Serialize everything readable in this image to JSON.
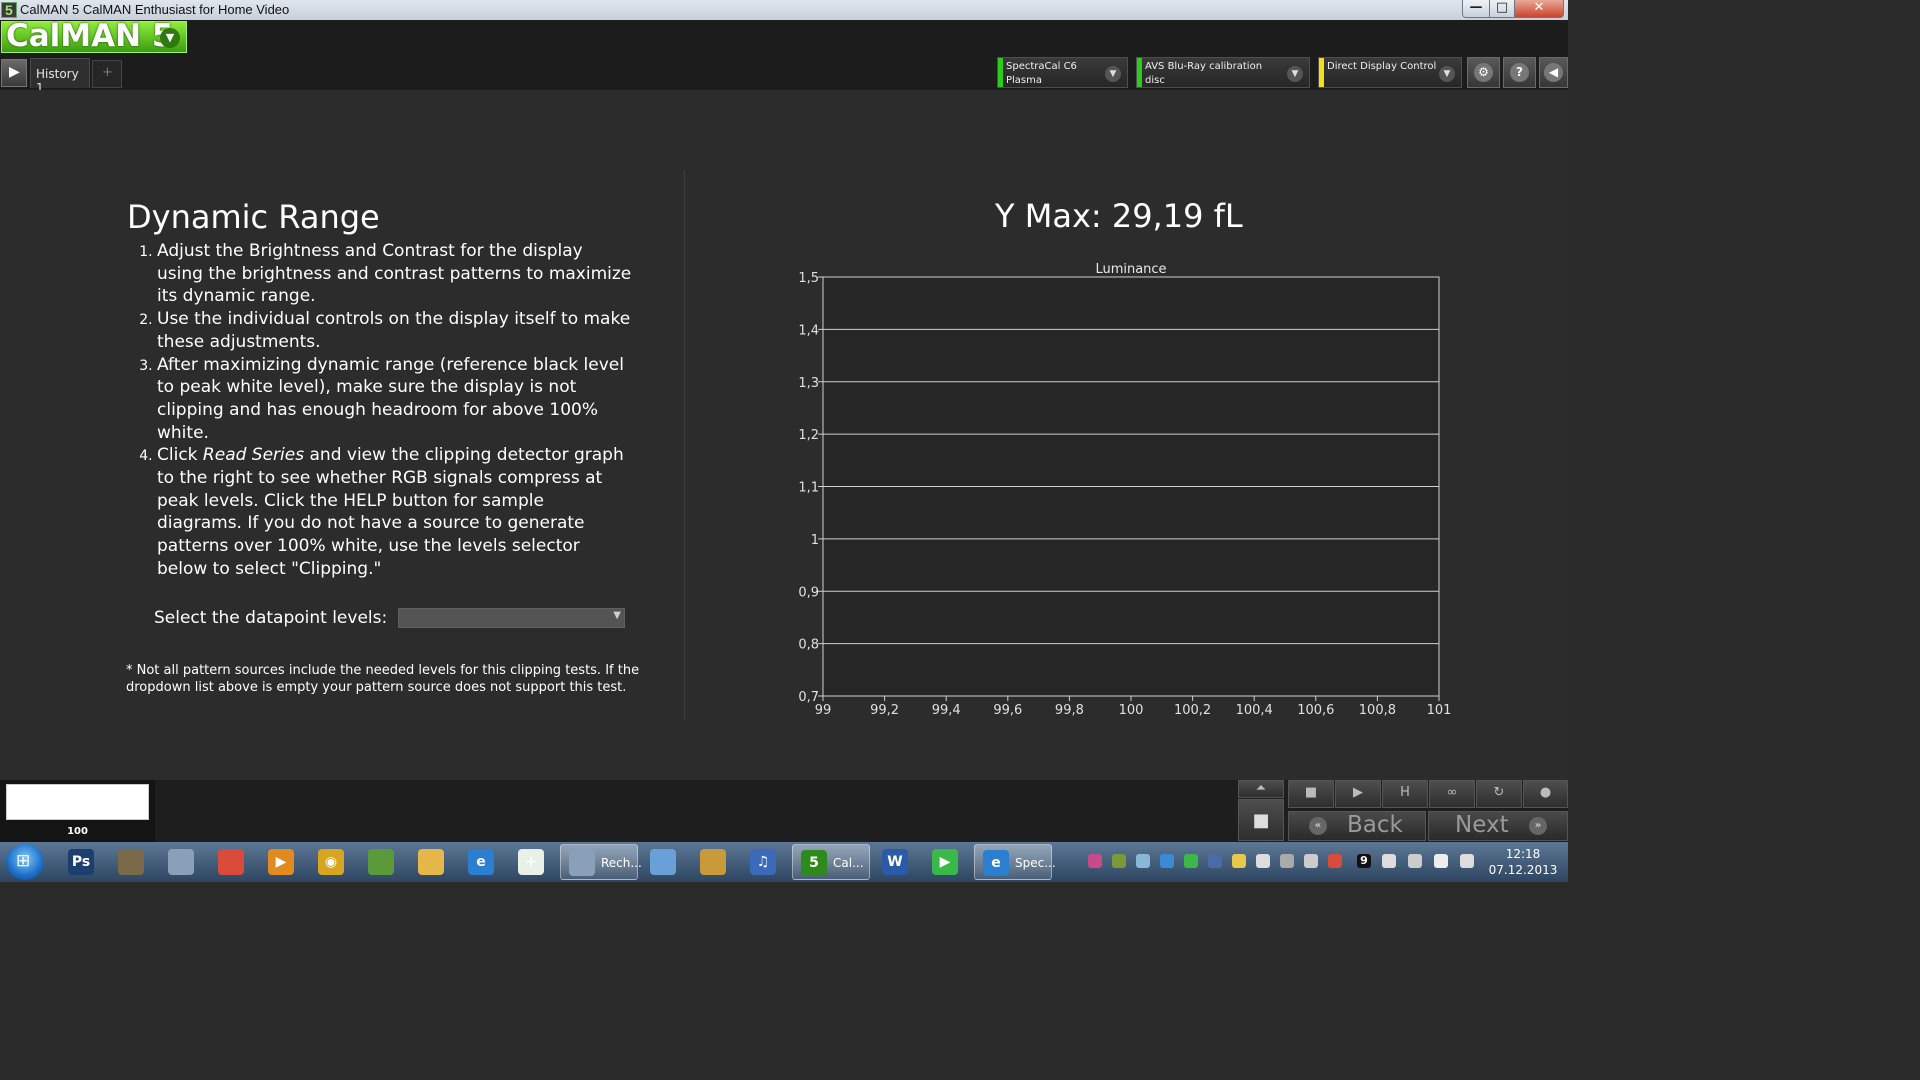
{
  "window": {
    "title": "CalMAN 5 CalMAN Enthusiast for Home Video",
    "app_icon_glyph": "5",
    "minimize_glyph": "—",
    "maximize_glyph": "□",
    "close_glyph": "✕"
  },
  "header": {
    "logo": "CalMAN 5",
    "logo_dropdown_glyph": "▼",
    "play_glyph": "▶",
    "tabs": [
      {
        "label": "History 1"
      }
    ],
    "add_tab_glyph": "+",
    "devices": [
      {
        "label": "SpectraCal C6 Plasma",
        "stripe_color": "#2ecc1a"
      },
      {
        "label": "AVS Blu-Ray calibration disc",
        "stripe_color": "#2ecc1a"
      },
      {
        "label": "Direct Display Control",
        "stripe_color": "#f2e01a"
      }
    ],
    "settings_glyph": "⚙",
    "help_glyph": "?",
    "collapse_glyph": "◀"
  },
  "content": {
    "title": "Dynamic Range",
    "steps": [
      {
        "text": "Adjust the Brightness and Contrast for the display using the brightness and contrast patterns to maximize its dynamic range."
      },
      {
        "text": "Use the individual controls on the display itself to make these adjustments."
      },
      {
        "text": "After maximizing dynamic range (reference black level to peak white level), make sure the display is not clipping and has enough headroom for above 100% white."
      },
      {
        "text_before": "Click ",
        "text_italic": "Read Series",
        "text_after": " and view the clipping detector graph to the right to see whether RGB signals compress at peak levels. Click the HELP button for sample diagrams. If you do not have a source to generate patterns over 100% white, use the levels selector below to select \"Clipping.\""
      }
    ],
    "levels_label": "Select the datapoint levels:",
    "levels_value": "",
    "footnote": "* Not all pattern sources include the needed levels for this clipping tests.  If the dropdown list above is empty your pattern source does not support this test.",
    "ymax": "Y Max: 29,19 fL"
  },
  "chart_data": {
    "type": "line",
    "title": "Luminance",
    "xlim": [
      99,
      101
    ],
    "ylim": [
      0.7,
      1.5
    ],
    "x_ticks": [
      "99",
      "99,2",
      "99,4",
      "99,6",
      "99,8",
      "100",
      "100,2",
      "100,4",
      "100,6",
      "100,8",
      "101"
    ],
    "y_ticks": [
      "0,7",
      "0,8",
      "0,9",
      "1",
      "1,1",
      "1,2",
      "1,3",
      "1,4",
      "1,5"
    ],
    "grid": true,
    "series": []
  },
  "bottom": {
    "swatch_color": "#ffffff",
    "swatch_label": "100",
    "controls": {
      "up_glyph": "⏶",
      "stop_glyph": "■",
      "play_glyph": "▶",
      "save_glyph": "H",
      "loop_glyph": "∞",
      "refresh_glyph": "↻",
      "record_glyph": "●",
      "stop_big_glyph": "■",
      "back_label": "Back",
      "back_glyph": "«",
      "next_label": "Next",
      "next_glyph": "»"
    }
  },
  "taskbar": {
    "start_glyph": "⊞",
    "items": [
      {
        "name": "photoshop",
        "color": "#1d3f6e",
        "glyph": "Ps",
        "label": ""
      },
      {
        "name": "photo-viewer",
        "color": "#7a6a4a",
        "glyph": "",
        "label": ""
      },
      {
        "name": "computer",
        "color": "#8aa0b8",
        "glyph": "",
        "label": ""
      },
      {
        "name": "chrome",
        "color": "#d84a3a",
        "glyph": "",
        "label": ""
      },
      {
        "name": "media",
        "color": "#e08a20",
        "glyph": "▶",
        "label": ""
      },
      {
        "name": "eye-app",
        "color": "#d8a520",
        "glyph": "◉",
        "label": ""
      },
      {
        "name": "globe",
        "color": "#5a9a3a",
        "glyph": "",
        "label": ""
      },
      {
        "name": "mail",
        "color": "#e6b84a",
        "glyph": "",
        "label": ""
      },
      {
        "name": "internet-explorer",
        "color": "#2a7fd0",
        "glyph": "e",
        "label": ""
      },
      {
        "name": "first-aid",
        "color": "#e8f0e8",
        "glyph": "+",
        "label": ""
      },
      {
        "name": "calculator",
        "color": "#8aa0b8",
        "glyph": "",
        "label": "Rech..."
      },
      {
        "name": "network",
        "color": "#6aa0d8",
        "glyph": "",
        "label": ""
      },
      {
        "name": "disc",
        "color": "#c89a3a",
        "glyph": "",
        "label": ""
      },
      {
        "name": "itunes",
        "color": "#3a6ab8",
        "glyph": "♫",
        "label": ""
      },
      {
        "name": "calman",
        "color": "#2e8a1a",
        "glyph": "5",
        "label": "Cal..."
      },
      {
        "name": "word",
        "color": "#2a5aa8",
        "glyph": "W",
        "label": ""
      },
      {
        "name": "play-store",
        "color": "#3ab84a",
        "glyph": "▶",
        "label": ""
      },
      {
        "name": "internet-explorer-2",
        "color": "#2a7fd0",
        "glyph": "e",
        "label": "Spec..."
      }
    ],
    "tray_badge": "9",
    "clock_time": "12:18",
    "clock_date": "07.12.2013"
  }
}
